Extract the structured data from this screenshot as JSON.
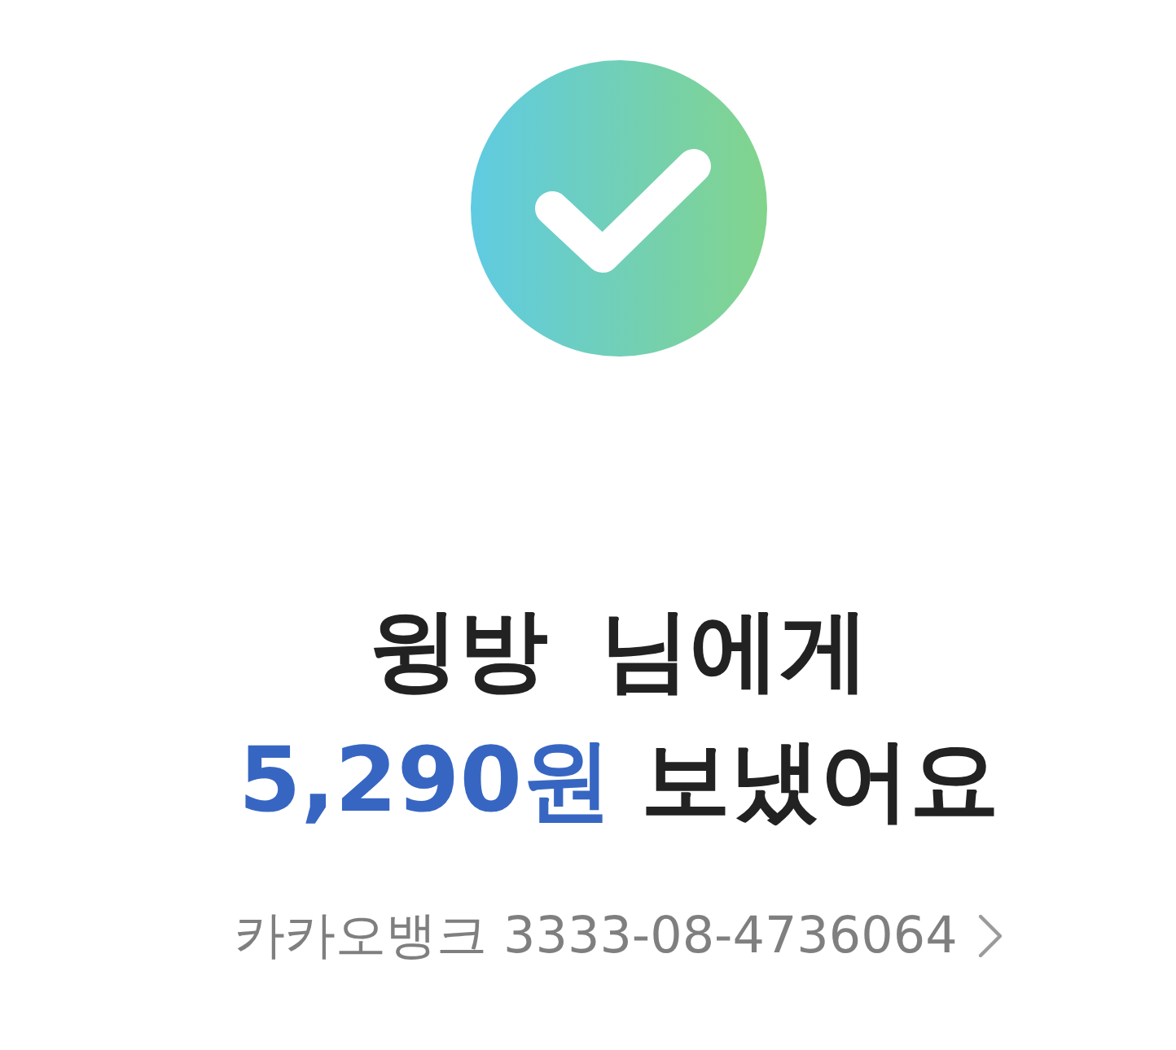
{
  "recipient": {
    "name": "윙방",
    "suffix": "님에게"
  },
  "transfer": {
    "amount": "5,290원",
    "verb": "보냈어요"
  },
  "account": {
    "label": "카카오뱅크 3333-08-4736064"
  }
}
